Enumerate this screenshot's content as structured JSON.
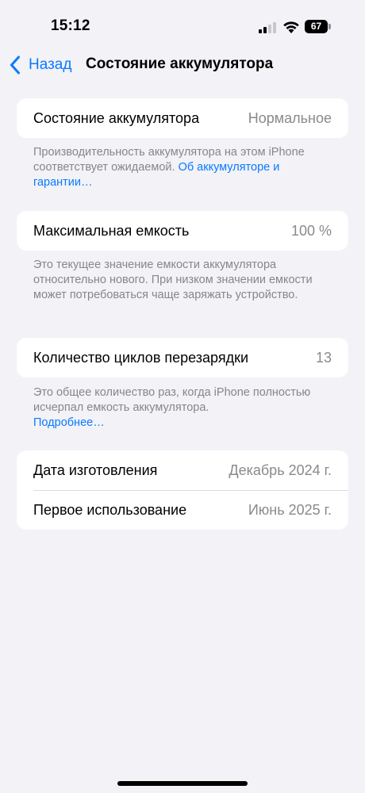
{
  "status_bar": {
    "time": "15:12",
    "battery_level": "67"
  },
  "nav": {
    "back_label": "Назад",
    "title": "Состояние аккумулятора"
  },
  "battery_health": {
    "label": "Состояние аккумулятора",
    "value": "Нормальное",
    "footnote_text": "Производительность аккумулятора на этом iPhone соответствует ожидаемой. ",
    "footnote_link": "Об аккумуля­торе и гарантии…"
  },
  "max_capacity": {
    "label": "Максимальная емкость",
    "value": "100 %",
    "footnote_text": "Это текущее значение емкости аккумулятора относительно нового. При низком значении емкости может потребоваться чаще заряжать устройство."
  },
  "cycle_count": {
    "label": "Количество циклов перезарядки",
    "value": "13",
    "footnote_text": "Это общее количество раз, когда iPhone полностью исчерпал емкость аккумулятора.",
    "footnote_link": "Подробнее…"
  },
  "dates": {
    "manufacture_label": "Дата изготовления",
    "manufacture_value": "Декабрь 2024 г.",
    "first_use_label": "Первое использование",
    "first_use_value": "Июнь 2025 г."
  },
  "colors": {
    "accent": "#0a7aff",
    "background": "#f2f2f7",
    "secondary_text": "#86868b"
  }
}
